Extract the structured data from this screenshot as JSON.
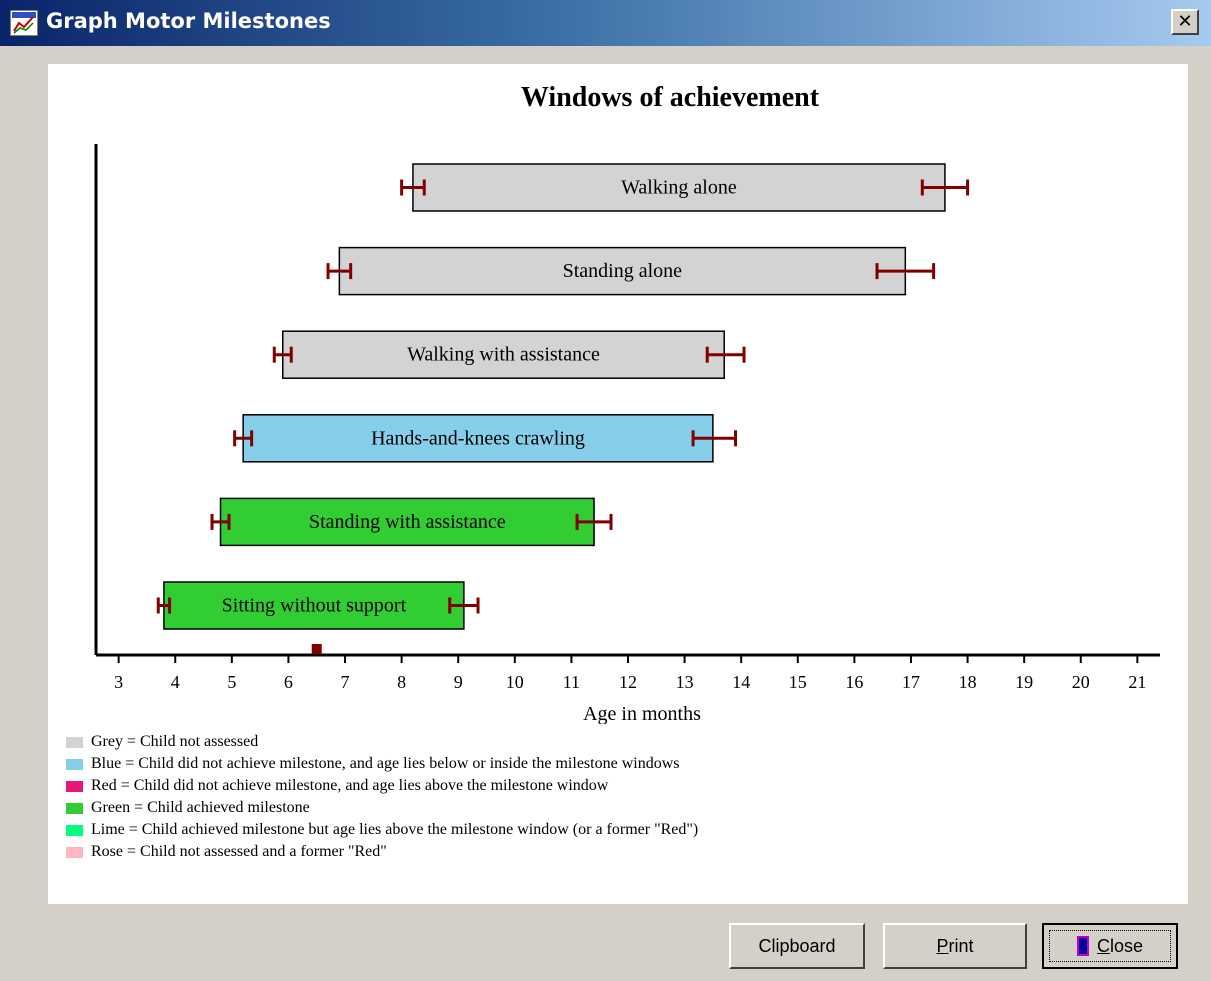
{
  "window": {
    "title": "Graph Motor Milestones",
    "close_glyph": "✕"
  },
  "chart_data": {
    "type": "bar",
    "title": "Windows of achievement",
    "xlabel": "Age in months",
    "ylabel": "",
    "xlim": [
      2.6,
      21.4
    ],
    "xticks": [
      3,
      4,
      5,
      6,
      7,
      8,
      9,
      10,
      11,
      12,
      13,
      14,
      15,
      16,
      17,
      18,
      19,
      20,
      21
    ],
    "child_age_marker": 6.5,
    "marker_color": "#800000",
    "milestones": [
      {
        "label": "Walking alone",
        "start": 8.2,
        "end": 17.6,
        "color": "#d3d3d3",
        "start_err": [
          8.0,
          8.4
        ],
        "end_err": [
          17.2,
          18.0
        ]
      },
      {
        "label": "Standing alone",
        "start": 6.9,
        "end": 16.9,
        "color": "#d3d3d3",
        "start_err": [
          6.7,
          7.1
        ],
        "end_err": [
          16.4,
          17.4
        ]
      },
      {
        "label": "Walking with assistance",
        "start": 5.9,
        "end": 13.7,
        "color": "#d3d3d3",
        "start_err": [
          5.75,
          6.05
        ],
        "end_err": [
          13.4,
          14.05
        ]
      },
      {
        "label": "Hands-and-knees crawling",
        "start": 5.2,
        "end": 13.5,
        "color": "#87ceeb",
        "start_err": [
          5.05,
          5.35
        ],
        "end_err": [
          13.15,
          13.9
        ]
      },
      {
        "label": "Standing with assistance",
        "start": 4.8,
        "end": 11.4,
        "color": "#32cd32",
        "start_err": [
          4.65,
          4.95
        ],
        "end_err": [
          11.1,
          11.7
        ]
      },
      {
        "label": "Sitting without support",
        "start": 3.8,
        "end": 9.1,
        "color": "#32cd32",
        "start_err": [
          3.7,
          3.9
        ],
        "end_err": [
          8.85,
          9.35
        ]
      }
    ]
  },
  "legend": [
    {
      "text": "Grey = Child not assessed",
      "color": "#d3d3d3"
    },
    {
      "text": "Blue = Child did not achieve milestone, and age lies below or inside the milestone windows",
      "color": "#87ceeb"
    },
    {
      "text": "Red = Child did not achieve milestone, and age lies above the milestone window",
      "color": "#e6197a"
    },
    {
      "text": "Green = Child achieved milestone",
      "color": "#32cd32"
    },
    {
      "text": "Lime = Child achieved milestone but age lies above the milestone window (or a former \"Red\")",
      "color": "#00ff7f"
    },
    {
      "text": "Rose = Child not assessed and a former \"Red\"",
      "color": "#ffb6c1"
    }
  ],
  "buttons": {
    "clipboard": "Clipboard",
    "print_underlined": "P",
    "print_rest": "rint",
    "close_underlined": "C",
    "close_rest": "lose"
  }
}
